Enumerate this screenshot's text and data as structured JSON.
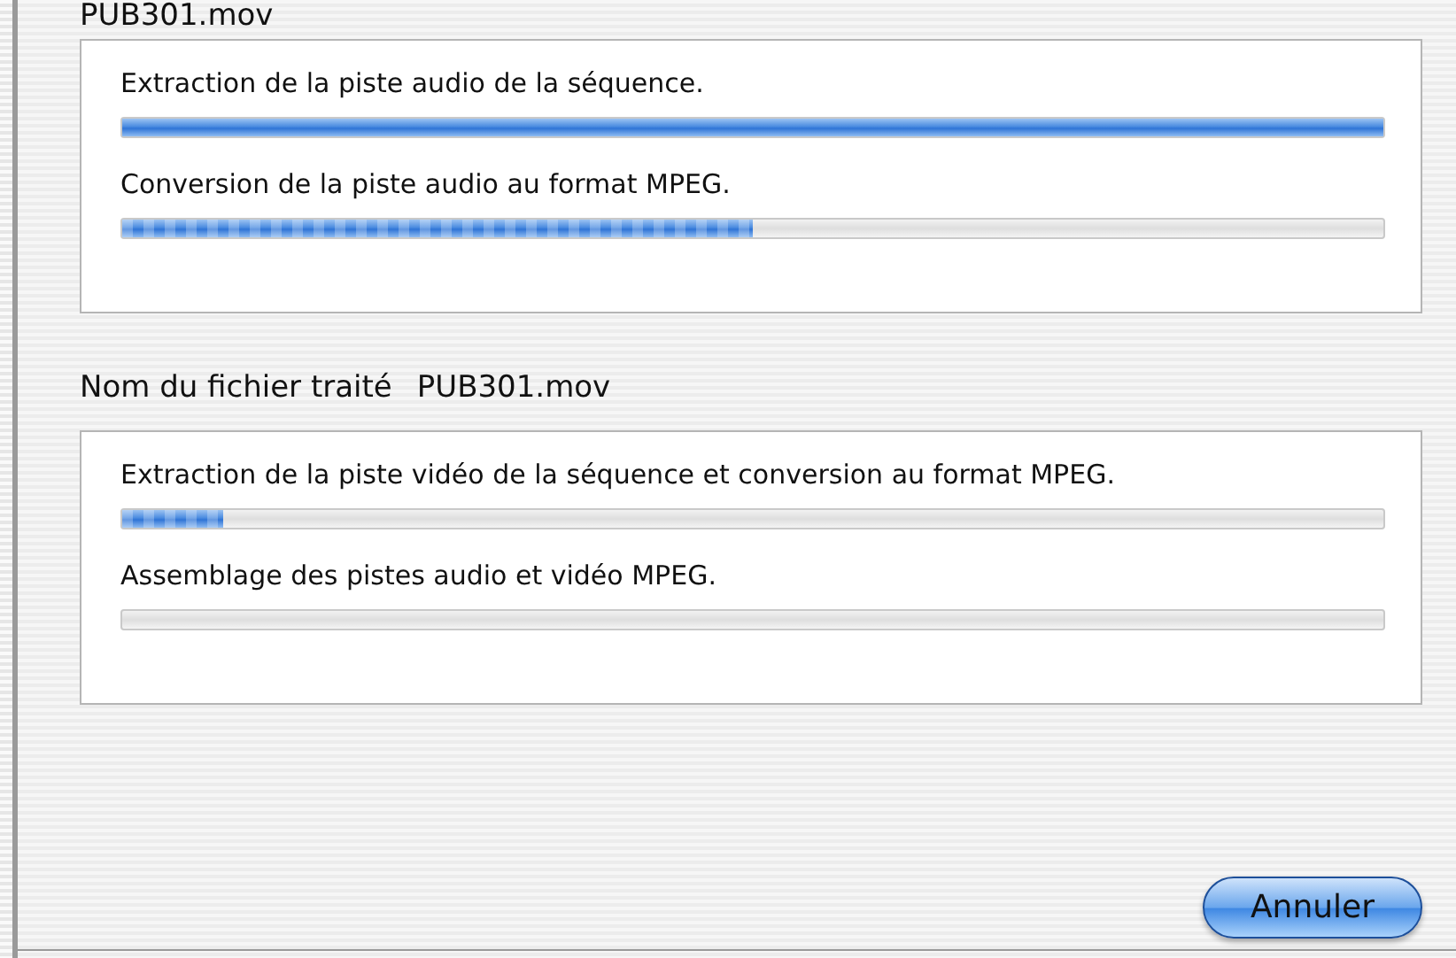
{
  "groups": [
    {
      "title": "PUB301.mov",
      "tasks": [
        {
          "label": "Extraction de la piste audio de la séquence.",
          "level": 1.0
        },
        {
          "label": "Conversion de la piste audio au format MPEG.",
          "level": 0.5
        }
      ]
    },
    {
      "title": "Nom du fichier traité",
      "overlay_title": "PUB301.mov",
      "tasks": [
        {
          "label": "Extraction de la piste vidéo de la séquence et conversion au format MPEG.",
          "level": 0.08
        },
        {
          "label": "Assemblage des pistes audio et vidéo MPEG.",
          "level": 0
        }
      ]
    }
  ],
  "cancel_button": "Annuler"
}
